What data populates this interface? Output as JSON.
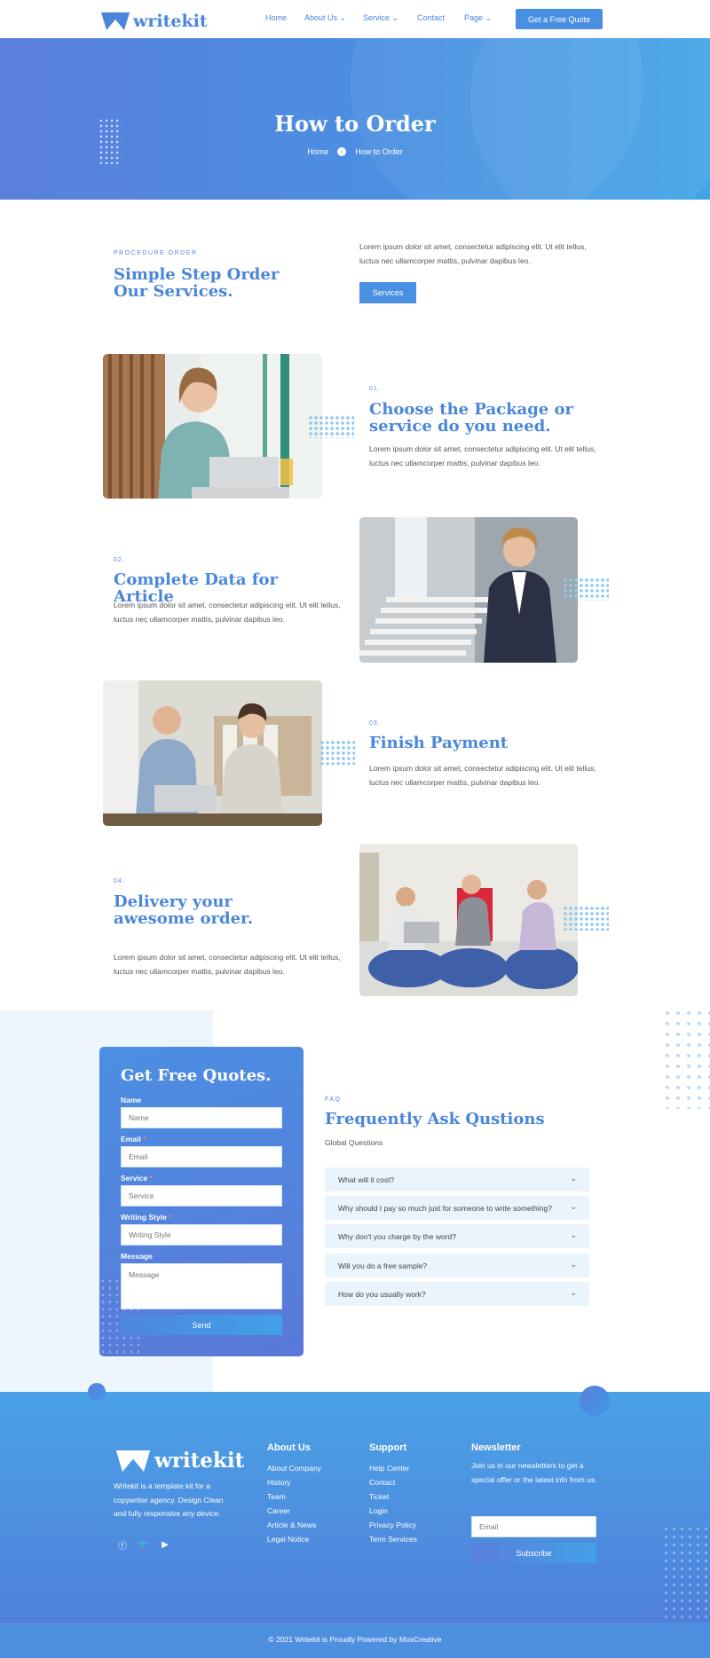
{
  "brand": {
    "name": "writekit"
  },
  "nav": {
    "items": [
      {
        "label": "Home"
      },
      {
        "label": "About Us",
        "has_dropdown": true
      },
      {
        "label": "Service",
        "has_dropdown": true
      },
      {
        "label": "Contact"
      },
      {
        "label": "Page",
        "has_dropdown": true
      }
    ],
    "cta": "Get a Free Quote"
  },
  "hero": {
    "title": "How to Order",
    "breadcrumb": [
      "Home",
      "How to Order"
    ]
  },
  "intro": {
    "eyebrow": "PROCEDURE ORDER",
    "heading": "Simple Step Order Our Services.",
    "text": "Lorem ipsum dolor sit amet, consectetur adipiscing elit. Ut elit tellus, luctus nec ullamcorper mattis, pulvinar dapibus leo.",
    "button": "Services"
  },
  "steps": [
    {
      "num": "01.",
      "title": "Choose the Package or service do you need.",
      "text": "Lorem ipsum dolor sit amet, consectetur adipiscing elit. Ut elit tellus, luctus nec ullamcorper mattis, pulvinar dapibus leo."
    },
    {
      "num": "02.",
      "title": "Complete Data for Article",
      "text": "Lorem ipsum dolor sit amet, consectetur adipiscing elit. Ut elit tellus, luctus nec ullamcorper mattis, pulvinar dapibus leo."
    },
    {
      "num": "03.",
      "title": "Finish Payment",
      "text": "Lorem ipsum dolor sit amet, consectetur adipiscing elit. Ut elit tellus, luctus nec ullamcorper mattis, pulvinar dapibus leo."
    },
    {
      "num": "04.",
      "title": "Delivery your awesome order.",
      "text": "Lorem ipsum dolor sit amet, consectetur adipiscing elit. Ut elit tellus, luctus nec ullamcorper mattis, pulvinar dapibus leo."
    }
  ],
  "form": {
    "title": "Get Free Quotes.",
    "fields": [
      {
        "label": "Name",
        "placeholder": "Name"
      },
      {
        "label": "Email",
        "placeholder": "Email"
      },
      {
        "label": "Service",
        "placeholder": "Service"
      },
      {
        "label": "Writing Style",
        "placeholder": "Writing Style"
      },
      {
        "label": "Message",
        "placeholder": "Message"
      }
    ],
    "required_mark": "*",
    "submit": "Send"
  },
  "faq": {
    "eyebrow": "FAQ",
    "heading": "Frequently Ask Qustions",
    "subheading": "Global Questions",
    "items": [
      "What will it cost?",
      "Why should I pay so much just for someone to write something?",
      "Why don't you charge by the word?",
      "Will you do a free sample?",
      "How do you usually work?"
    ]
  },
  "footer": {
    "about": "Writekit is a template kit for a copywriter agency. Design Clean and fully responsive any device.",
    "columns": [
      {
        "title": "About Us",
        "links": [
          "About Company",
          "History",
          "Team",
          "Career",
          "Article & News",
          "Legal Notice"
        ]
      },
      {
        "title": "Support",
        "links": [
          "Help Center",
          "Contact",
          "Ticket",
          "Login",
          "Privacy Policy",
          "Term Services"
        ]
      }
    ],
    "newsletter": {
      "title": "Newsletter",
      "text": "Join us in our newsletters to get a special offer or the latest info from us.",
      "placeholder": "Email",
      "button": "Subscribe"
    },
    "copyright": "© 2021 Writekit is Proudly Powered by MoxCreative"
  },
  "colors": {
    "primary": "#4a86d9",
    "accent": "#4a90e2",
    "light_bg": "#eef6fd"
  }
}
